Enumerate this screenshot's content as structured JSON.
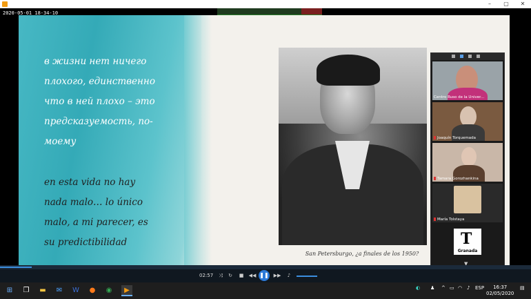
{
  "window": {
    "timestamp": "2020-05-01 18-34-10",
    "buttons": [
      "–",
      "▢",
      "✕"
    ]
  },
  "slide": {
    "poem_ru": [
      "в жизни нет ничего",
      "плохого, единственно",
      "что в ней плохо – это",
      "предсказуемость, по-",
      "моему"
    ],
    "poem_es": [
      "en esta vida no hay",
      "nada malo… lo único",
      "malo, a mi parecer,  es",
      "su predictibilidad"
    ],
    "caption": "San Petersburgo, ¿a finales de los 1950?"
  },
  "zoom": {
    "participants": [
      {
        "name": "Centro Ruso de la Univer...",
        "muted": false
      },
      {
        "name": "Joaquín Torquemada",
        "muted": true
      },
      {
        "name": "Tamara Gorozhankina",
        "muted": true
      },
      {
        "name": "María Tolstaya",
        "muted": true
      }
    ],
    "logo": {
      "letter": "T",
      "name": "Granada"
    }
  },
  "player": {
    "time": "02:57",
    "progress_fraction": 0.06
  },
  "taskbar": {
    "lang": "ESP",
    "time": "16:37",
    "date": "02/05/2020"
  }
}
